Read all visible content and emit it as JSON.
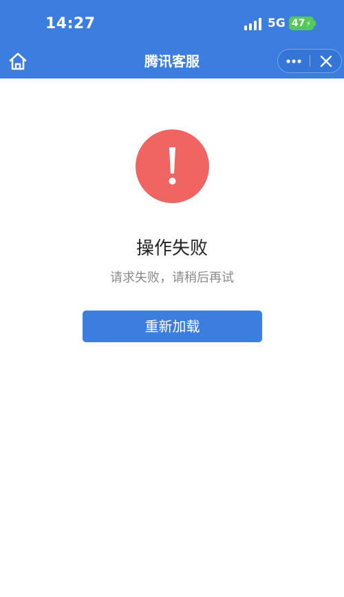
{
  "status_bar": {
    "time": "14:27",
    "network": "5G",
    "battery": "47",
    "signal_icon": "signal-bars-icon",
    "battery_color": "#55c85a"
  },
  "nav_bar": {
    "title": "腾讯客服",
    "home_icon": "home-icon",
    "more_icon": "more-dots-icon",
    "close_icon": "close-icon",
    "background_color": "#3b7ee0"
  },
  "main": {
    "icon": "exclamation-icon",
    "icon_color": "#f06462",
    "title": "操作失败",
    "message": "请求失败，请稍后再试",
    "reload_button_label": "重新加载",
    "button_color": "#3b7ee0"
  }
}
